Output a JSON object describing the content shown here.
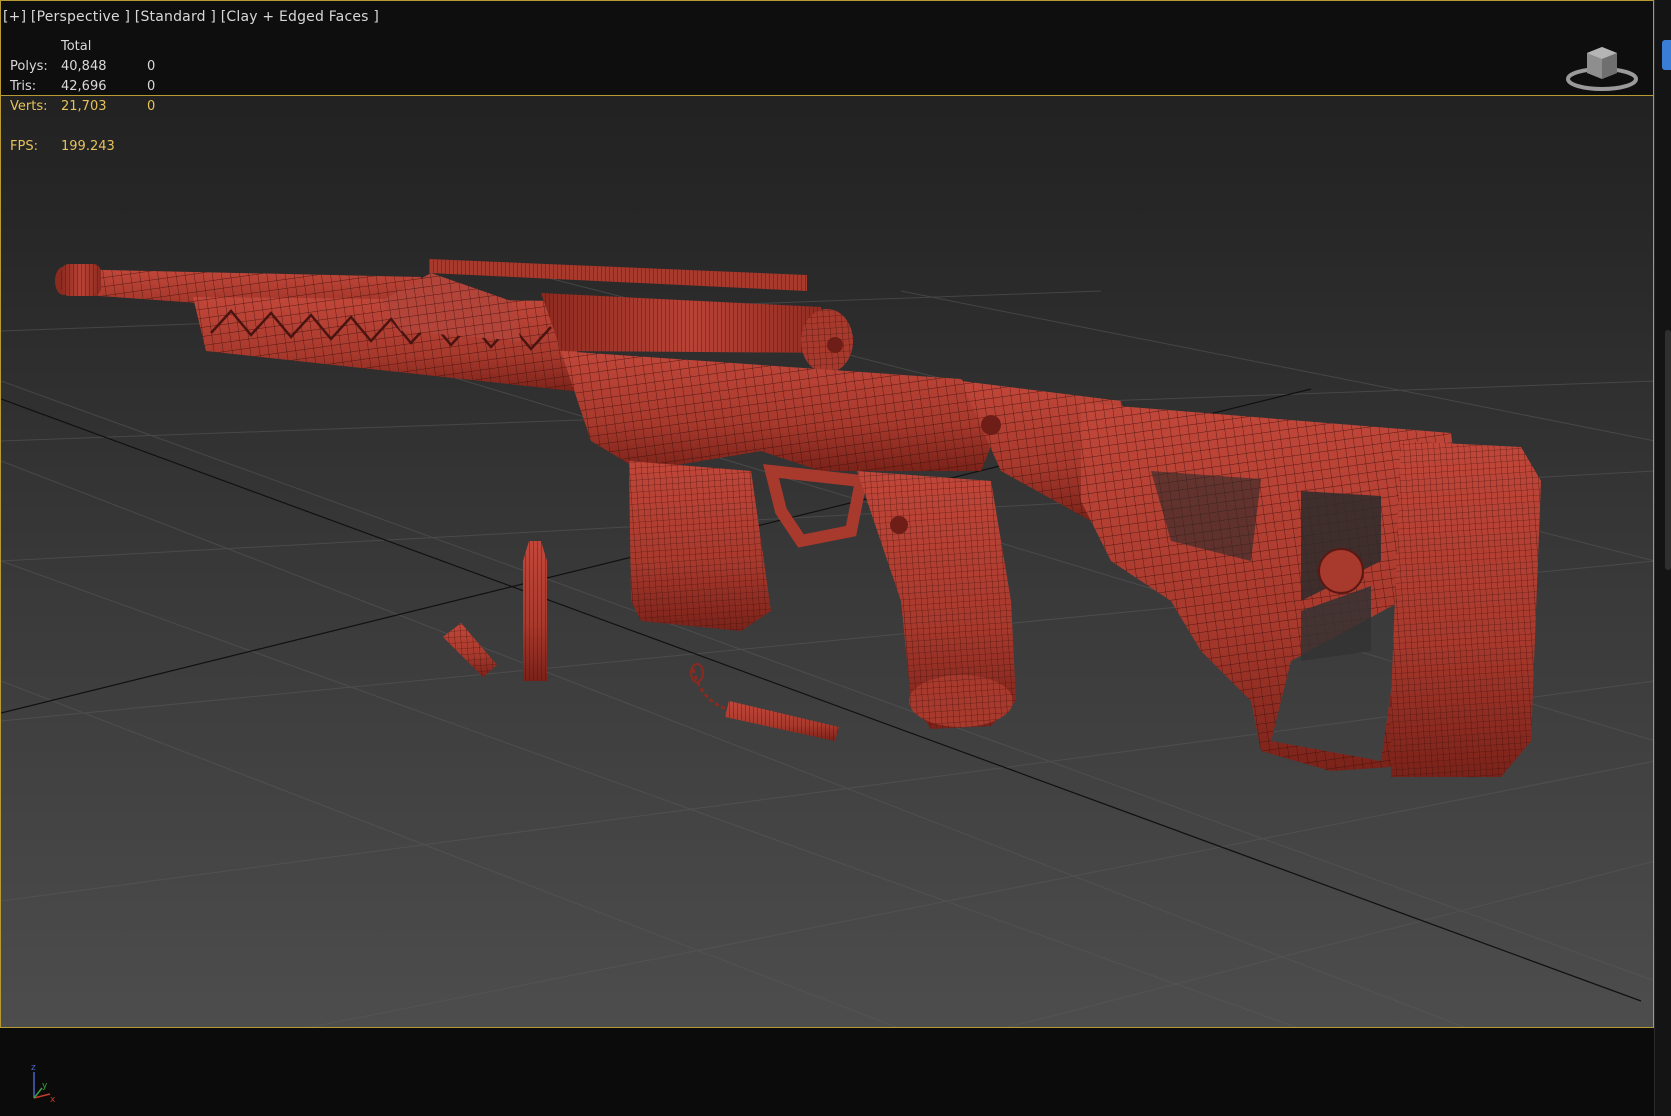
{
  "viewport": {
    "label": "[+] [Perspective ] [Standard ] [Clay + Edged Faces ]"
  },
  "stats": {
    "total_label": "Total",
    "polys_label": "Polys:",
    "polys_total": "40,848",
    "polys_selected": "0",
    "tris_label": "Tris:",
    "tris_total": "42,696",
    "tris_selected": "0",
    "verts_label": "Verts:",
    "verts_total": "21,703",
    "verts_selected": "0",
    "fps_label": "FPS:",
    "fps_value": "199.243"
  },
  "axis_gizmo": {
    "x": "x",
    "y": "y",
    "z": "z"
  },
  "icons": [
    "viewcube-icon",
    "axis-gizmo-icon"
  ],
  "colors": {
    "model_clay": "#a8392d",
    "model_clay_dark": "#6e1e17",
    "wire": "#3a0d09",
    "viewport_border": "#b79a36",
    "stats_highlight": "#e6c25a",
    "side_tab": "#3a7dd6"
  }
}
